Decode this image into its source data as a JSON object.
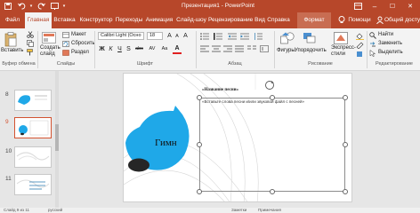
{
  "app": {
    "title": "Презентация1 - PowerPoint",
    "accent": "#b7472a"
  },
  "titlebar": {
    "save_icon": "save-icon",
    "undo_icon": "undo-icon",
    "redo_icon": "redo-icon",
    "present_icon": "slideshow-icon",
    "customize_icon": "chevron-down-icon",
    "ribbon_display_icon": "ribbon-display-icon",
    "minimize": "–",
    "maximize": "☐",
    "close": "✕"
  },
  "tabs": [
    {
      "label": "Файл"
    },
    {
      "label": "Главная"
    },
    {
      "label": "Вставка"
    },
    {
      "label": "Конструктор"
    },
    {
      "label": "Переходы"
    },
    {
      "label": "Анимация"
    },
    {
      "label": "Слайд-шоу"
    },
    {
      "label": "Рецензирование"
    },
    {
      "label": "Вид"
    },
    {
      "label": "Справка"
    },
    {
      "label": "Формат"
    }
  ],
  "tell_me": "Помощи",
  "share": "Общий досту",
  "ribbon": {
    "clipboard": {
      "paste": "Вставить",
      "cut_icon": "cut-icon",
      "copy_icon": "copy-icon",
      "format_painter_icon": "format-painter-icon",
      "label": "Буфер обмена"
    },
    "slides": {
      "new_slide": "Создать слайд",
      "layout": "Макет",
      "reset": "Сбросить",
      "section": "Раздел",
      "label": "Слайды"
    },
    "font": {
      "name": "Calibri Light (Осно",
      "size": "18",
      "bold": "Ж",
      "italic": "К",
      "underline": "Ч",
      "shadow": "S",
      "strike": "abc",
      "spacing": "AV",
      "case": "Aa",
      "grow": "A",
      "shrink": "A",
      "clear": "A",
      "color": "A",
      "label": "Шрифт"
    },
    "paragraph": {
      "label": "Абзац"
    },
    "drawing": {
      "shapes": "Фигуры",
      "arrange": "Упорядочить",
      "quick_styles": "Экспресс-стили",
      "label": "Рисование"
    },
    "editing": {
      "find": "Найти",
      "replace": "Заменить",
      "select": "Выделить",
      "label": "Редактирование"
    }
  },
  "thumbnails": [
    {
      "number": "8"
    },
    {
      "number": "9"
    },
    {
      "number": "10"
    },
    {
      "number": "11"
    }
  ],
  "slide": {
    "title_placeholder": "«Название песни»",
    "body_placeholder": "«Вставьте слова песни и/или звуковой файл с песней»",
    "bubble_text": "Гимн",
    "bubble_color": "#1fa8e8",
    "dark_shape_color": "#262626"
  },
  "statusbar": {
    "slide_info": "Слайд 9 из 11",
    "language": "русский",
    "notes": "Заметки",
    "comments": "Примечания"
  }
}
